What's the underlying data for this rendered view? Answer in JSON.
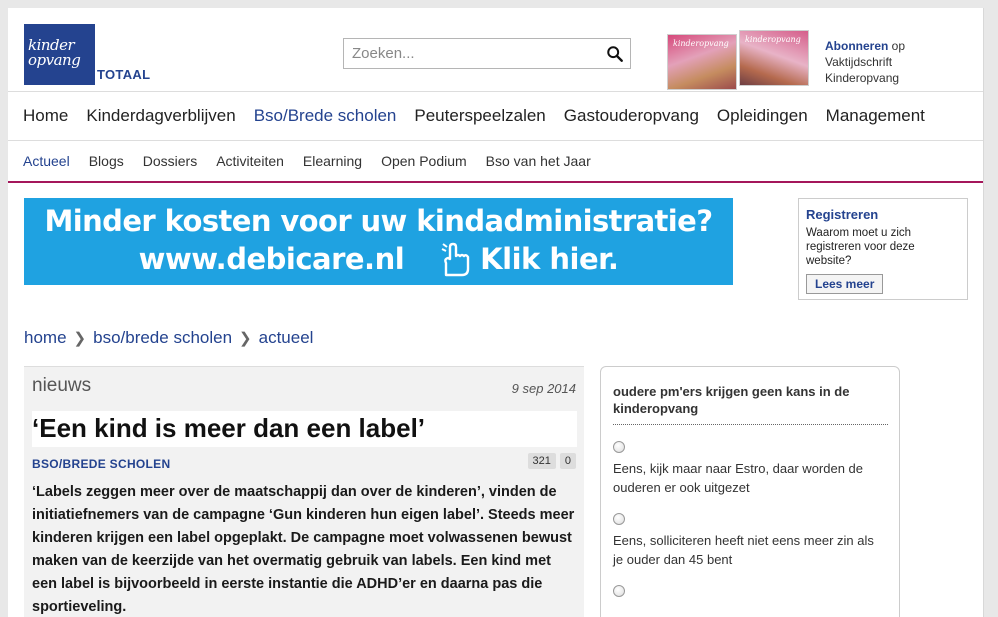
{
  "header": {
    "logo_text": "kinder opvang",
    "logo_suffix": "TOTAAL",
    "search_placeholder": "Zoeken...",
    "subscribe_link": "Abonneren",
    "subscribe_rest": " op Vaktijdschrift Kinderopvang"
  },
  "mainnav": [
    "Home",
    "Kinderdagverblijven",
    "Bso/Brede scholen",
    "Peuterspeelzalen",
    "Gastouderopvang",
    "Opleidingen",
    "Management"
  ],
  "subnav": [
    "Actueel",
    "Blogs",
    "Dossiers",
    "Activiteiten",
    "Elearning",
    "Open Podium",
    "Bso van het Jaar"
  ],
  "banner": {
    "line1": "Minder kosten voor uw kindadministratie?",
    "url": "www.debicare.nl",
    "cta": "Klik hier."
  },
  "register": {
    "title": "Registreren",
    "text": "Waarom moet u zich registreren voor deze website?",
    "button": "Lees meer"
  },
  "breadcrumb": [
    "home",
    "bso/brede scholen",
    "actueel"
  ],
  "article": {
    "label": "nieuws",
    "date": "9 sep 2014",
    "title": "‘Een kind is meer dan een label’",
    "category": "BSO/BREDE SCHOLEN",
    "count_views": "321",
    "count_comments": "0",
    "lead": "‘Labels zeggen meer over de maatschappij dan over de kinderen’, vinden de initiatiefnemers van de campagne ‘Gun kinderen hun eigen label’. Steeds meer kinderen krijgen een label opgeplakt. De campagne moet volwassenen bewust maken van de keerzijde van het overmatig gebruik van labels. Een kind met een label is bijvoorbeeld in eerste instantie die ADHD’er en daarna pas die sportieveling."
  },
  "poll": {
    "question": "oudere pm'ers krijgen geen kans in de kinderopvang",
    "options": [
      "Eens, kijk maar naar Estro, daar worden de ouderen er ook uitgezet",
      "Eens, solliciteren heeft niet eens meer zin als je ouder dan 45 bent"
    ]
  },
  "colors": {
    "brand_blue": "#24438f",
    "accent_magenta": "#a4175b",
    "banner_blue": "#1fa2e1"
  }
}
